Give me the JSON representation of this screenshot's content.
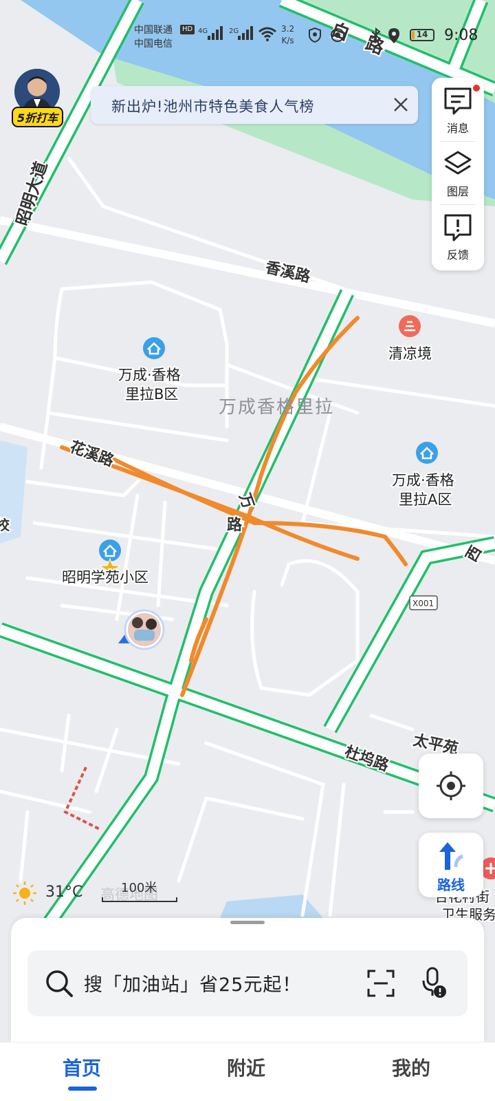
{
  "status_bar": {
    "carrier_1": "中国联通",
    "carrier_2": "中国电信",
    "hd": "HD",
    "net_1": "4G",
    "net_2": "2G",
    "speed_value": "3.2",
    "speed_unit": "K/s",
    "battery_level": "14",
    "battery_fraction": 0.14,
    "time": "9:08"
  },
  "avatar": {
    "badge": "5折打车"
  },
  "banner": {
    "text": "新出炉!池州市特色美食人气榜",
    "close_icon": "close-icon"
  },
  "toolbar": {
    "items": [
      {
        "label": "消息",
        "icon": "message-icon",
        "has_dot": true
      },
      {
        "label": "图层",
        "icon": "layers-icon"
      },
      {
        "label": "反馈",
        "icon": "feedback-icon"
      }
    ]
  },
  "map": {
    "road_labels": [
      "昭明大道",
      "香溪路",
      "花溪路",
      "万",
      "路",
      "杜坞路",
      "西",
      "白",
      "路"
    ],
    "poi": [
      {
        "name": "清凉境",
        "icon": "scenic-pin-icon"
      },
      {
        "name": "万成·香格",
        "name2": "里拉B区",
        "icon": "residential-pin-icon"
      },
      {
        "name": "万成·香格",
        "name2": "里拉A区",
        "icon": "residential-pin-icon"
      },
      {
        "name": "昭明学苑小区",
        "icon": "residential-pin-icon"
      },
      {
        "name": "合花衬街",
        "name2": "卫生服务",
        "icon": "hospital-pin-icon"
      }
    ],
    "area_label": "万成香格里拉",
    "road_code": "X001",
    "partial_labels": [
      "校",
      "太平苑"
    ],
    "colors": {
      "road_outline": "#1fbf6a",
      "water": "#93c7ef",
      "park": "#b6e8c8",
      "track": "#f08a2c",
      "background": "#ebecef"
    }
  },
  "weather": {
    "icon": "sun-icon",
    "temp": "31°C",
    "brand": "高德地图"
  },
  "scale": {
    "text": "100米"
  },
  "controls": {
    "locate_icon": "locate-icon",
    "route_label": "路线",
    "route_icon": "route-arrow-icon"
  },
  "search": {
    "placeholder": "搜「加油站」省25元起！",
    "search_icon": "search-icon",
    "scan_icon": "scan-icon",
    "mic_icon": "mic-icon"
  },
  "tabs": [
    {
      "label": "首页",
      "active": true
    },
    {
      "label": "附近",
      "active": false
    },
    {
      "label": "我的",
      "active": false
    }
  ]
}
